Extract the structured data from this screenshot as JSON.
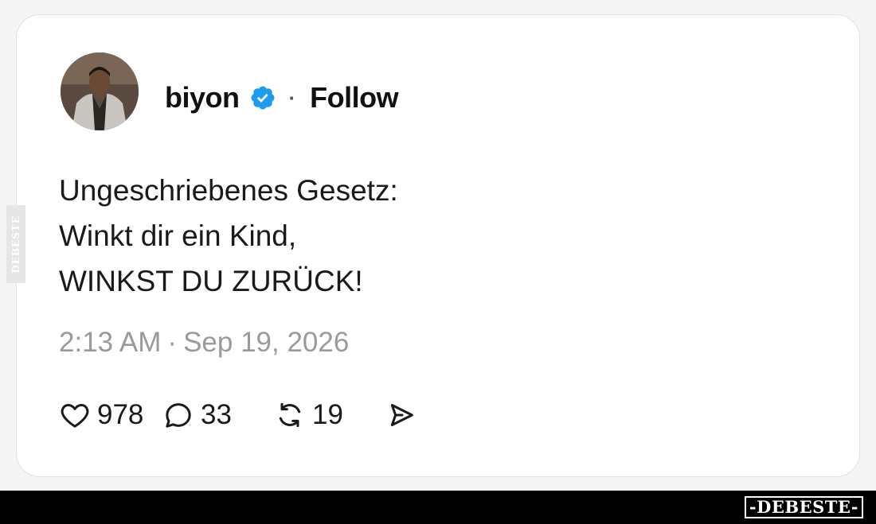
{
  "post": {
    "author": {
      "name": "biyon",
      "verified": true,
      "follow_label": "Follow",
      "separator": "·"
    },
    "text_lines": [
      "Ungeschriebenes Gesetz:",
      "Winkt dir ein Kind,",
      "WINKST DU ZURÜCK!"
    ],
    "time": "2:13 AM",
    "date": "Sep 19, 2026",
    "time_separator": "·",
    "actions": {
      "likes": "978",
      "replies": "33",
      "reposts": "19"
    }
  },
  "icons": {
    "verified": "verified-badge-icon",
    "like": "heart-icon",
    "reply": "speech-bubble-icon",
    "repost": "repost-arrows-icon",
    "share": "send-arrow-icon"
  },
  "colors": {
    "verified_blue": "#1d9bf0",
    "timestamp_gray": "#9a9a9a",
    "card_border": "#e2e2e2"
  },
  "watermark": {
    "side": "DEBESTE",
    "footer": "-DEBESTE-"
  }
}
